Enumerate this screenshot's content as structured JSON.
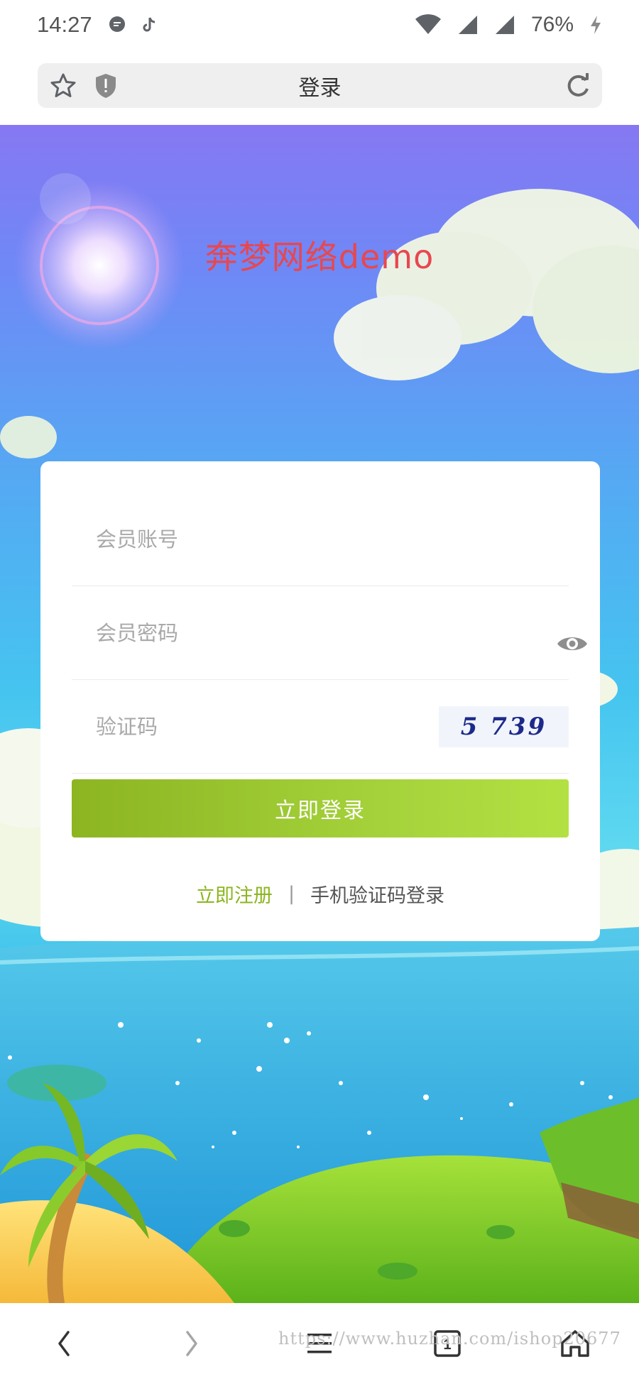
{
  "status_bar": {
    "time": "14:27",
    "battery": "76%",
    "icons": [
      "message-icon",
      "tiktok-icon",
      "wifi-icon",
      "signal-icon",
      "signal-icon",
      "charging-icon"
    ]
  },
  "browser": {
    "page_title": "登录",
    "icons": [
      "star-icon",
      "shield-warning-icon",
      "refresh-icon"
    ]
  },
  "page": {
    "brand_title": "奔梦网络demo"
  },
  "login_form": {
    "username_placeholder": "会员账号",
    "password_placeholder": "会员密码",
    "captcha_placeholder": "验证码",
    "captcha_text": "5 739",
    "submit_label": "立即登录",
    "register_link": "立即注册",
    "separator": "|",
    "sms_login_link": "手机验证码登录"
  },
  "bottom_nav": {
    "items": [
      "back-icon",
      "forward-icon",
      "menu-icon",
      "tabs-icon",
      "home-icon"
    ],
    "tabs_count": "1",
    "watermark": "https://www.huzhan.com/ishop20677"
  },
  "colors": {
    "accent_green": "#8cb521",
    "brand_red": "#e8474f",
    "captcha_text": "#1e2a8a"
  }
}
